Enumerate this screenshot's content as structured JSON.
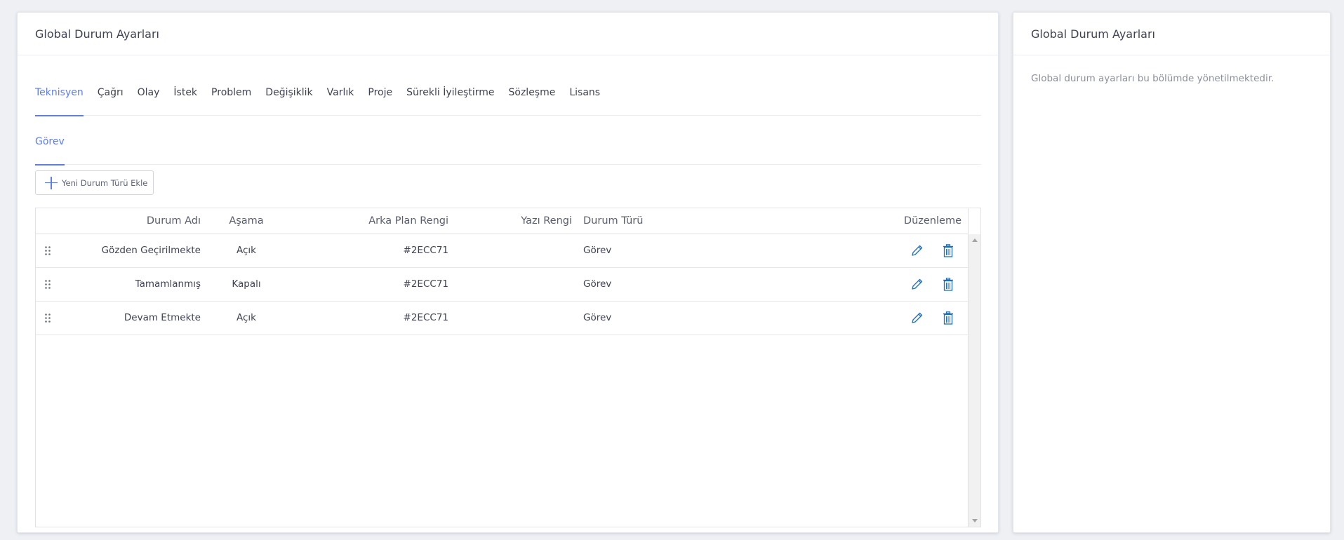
{
  "main_card": {
    "title": "Global Durum Ayarları"
  },
  "side_card": {
    "title": "Global Durum Ayarları",
    "description": "Global durum ayarları bu bölümde yönetilmektedir."
  },
  "tabs": [
    {
      "label": "Teknisyen",
      "active": true
    },
    {
      "label": "Çağrı"
    },
    {
      "label": "Olay"
    },
    {
      "label": "İstek"
    },
    {
      "label": "Problem"
    },
    {
      "label": "Değişiklik"
    },
    {
      "label": "Varlık"
    },
    {
      "label": "Proje"
    },
    {
      "label": "Sürekli İyileştirme"
    },
    {
      "label": "Sözleşme"
    },
    {
      "label": "Lisans"
    }
  ],
  "subtabs": [
    {
      "label": "Görev",
      "active": true
    }
  ],
  "add_button": {
    "label": "Yeni Durum Türü Ekle",
    "icon": "plus-icon"
  },
  "grid": {
    "columns": [
      "Durum Adı",
      "Aşama",
      "Arka Plan Rengi",
      "Yazı Rengi",
      "Durum Türü",
      "Düzenleme"
    ],
    "rows": [
      {
        "name": "Gözden Geçirilmekte",
        "stage": "Açık",
        "bg_color": "#2ECC71",
        "text_color": "",
        "type": "Görev"
      },
      {
        "name": "Tamamlanmış",
        "stage": "Kapalı",
        "bg_color": "#2ECC71",
        "text_color": "",
        "type": "Görev"
      },
      {
        "name": "Devam Etmekte",
        "stage": "Açık",
        "bg_color": "#2ECC71",
        "text_color": "",
        "type": "Görev"
      }
    ]
  },
  "colors": {
    "accent": "#5b7df0",
    "action_icon": "#1f6fb8"
  }
}
